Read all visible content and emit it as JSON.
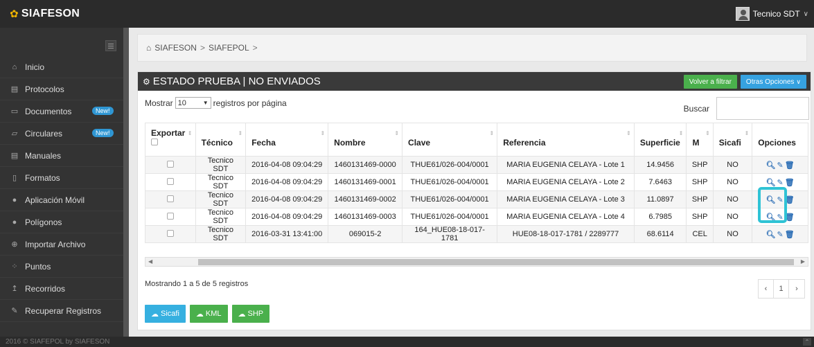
{
  "header": {
    "app_name": "SIAFESON",
    "user_name": "Tecnico SDT"
  },
  "sidebar": {
    "items": [
      {
        "label": "Inicio",
        "icon": "home-icon",
        "glyph": "⌂",
        "badge": ""
      },
      {
        "label": "Protocolos",
        "icon": "book-icon",
        "glyph": "▤",
        "badge": ""
      },
      {
        "label": "Documentos",
        "icon": "folder-icon",
        "glyph": "▭",
        "badge": "New!"
      },
      {
        "label": "Circulares",
        "icon": "folder-open-icon",
        "glyph": "▱",
        "badge": "New!"
      },
      {
        "label": "Manuales",
        "icon": "book-icon",
        "glyph": "▤",
        "badge": ""
      },
      {
        "label": "Formatos",
        "icon": "file-icon",
        "glyph": "▯",
        "badge": ""
      },
      {
        "label": "Aplicación Móvil",
        "icon": "android-icon",
        "glyph": "●",
        "badge": ""
      },
      {
        "label": "Polígonos",
        "icon": "circle-icon",
        "glyph": "●",
        "badge": ""
      },
      {
        "label": "Importar Archivo",
        "icon": "upload-icon",
        "glyph": "⊕",
        "badge": ""
      },
      {
        "label": "Puntos",
        "icon": "spinner-icon",
        "glyph": "⁘",
        "badge": ""
      },
      {
        "label": "Recorridos",
        "icon": "arrow-up-icon",
        "glyph": "↥",
        "badge": ""
      },
      {
        "label": "Recuperar Registros",
        "icon": "wrench-icon",
        "glyph": "✎",
        "badge": ""
      }
    ]
  },
  "breadcrumb": {
    "items": [
      "SIAFESON",
      "SIAFEPOL"
    ],
    "separator": ">"
  },
  "panel": {
    "title": "ESTADO PRUEBA | NO ENVIADOS",
    "btn_filter": "Volver a filtrar",
    "btn_options": "Otras Opciones"
  },
  "controls": {
    "show_prefix": "Mostrar",
    "page_size": "10",
    "show_suffix": "registros por página",
    "search_label": "Buscar",
    "search_value": ""
  },
  "table": {
    "columns": [
      "Exportar",
      "Técnico",
      "Fecha",
      "Nombre",
      "Clave",
      "Referencia",
      "Superficie",
      "M",
      "Sicafi",
      "Opciones"
    ],
    "rows": [
      {
        "tecnico": "Tecnico SDT",
        "fecha": "2016-04-08 09:04:29",
        "nombre": "1460131469-0000",
        "clave": "THUE61/026-004/0001",
        "referencia": "MARIA EUGENIA CELAYA - Lote 1",
        "superficie": "14.9456",
        "m": "SHP",
        "sicafi": "NO"
      },
      {
        "tecnico": "Tecnico SDT",
        "fecha": "2016-04-08 09:04:29",
        "nombre": "1460131469-0001",
        "clave": "THUE61/026-004/0001",
        "referencia": "MARIA EUGENIA CELAYA - Lote 2",
        "superficie": "7.6463",
        "m": "SHP",
        "sicafi": "NO"
      },
      {
        "tecnico": "Tecnico SDT",
        "fecha": "2016-04-08 09:04:29",
        "nombre": "1460131469-0002",
        "clave": "THUE61/026-004/0001",
        "referencia": "MARIA EUGENIA CELAYA - Lote 3",
        "superficie": "11.0897",
        "m": "SHP",
        "sicafi": "NO"
      },
      {
        "tecnico": "Tecnico SDT",
        "fecha": "2016-04-08 09:04:29",
        "nombre": "1460131469-0003",
        "clave": "THUE61/026-004/0001",
        "referencia": "MARIA EUGENIA CELAYA - Lote 4",
        "superficie": "6.7985",
        "m": "SHP",
        "sicafi": "NO"
      },
      {
        "tecnico": "Tecnico SDT",
        "fecha": "2016-03-31 13:41:00",
        "nombre": "069015-2",
        "clave": "164_HUE08-18-017-1781",
        "referencia": "HUE08-18-017-1781 / 2289777",
        "superficie": "68.6114",
        "m": "CEL",
        "sicafi": "NO"
      }
    ]
  },
  "info_text": "Mostrando 1 a 5 de 5 registros",
  "pagination": {
    "prev": "‹",
    "current": "1",
    "next": "›"
  },
  "exports": [
    "Sicafi",
    "KML",
    "SHP"
  ],
  "footer_text": "2016 © SIAFEPOL by SIAFESON",
  "colors": {
    "accent_green": "#4ab04c",
    "accent_blue": "#36a2e0",
    "highlight": "#2fc3d5"
  }
}
